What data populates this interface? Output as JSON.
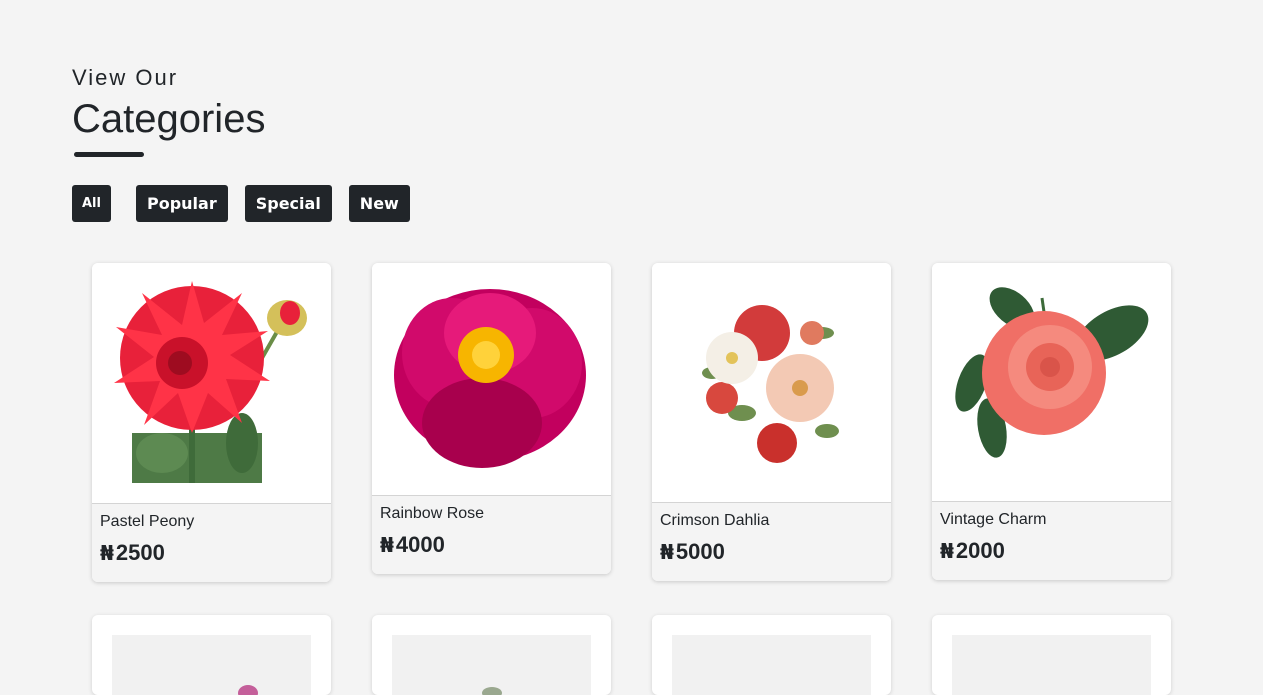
{
  "header": {
    "subtitle": "View Our",
    "title": "Categories"
  },
  "filters": [
    "All",
    "Popular",
    "Special",
    "New"
  ],
  "currency_symbol": "₦",
  "products": [
    {
      "name": "Pastel Peony",
      "price": "2500"
    },
    {
      "name": "Rainbow Rose",
      "price": "4000"
    },
    {
      "name": "Crimson Dahlia",
      "price": "5000"
    },
    {
      "name": "Vintage Charm",
      "price": "2000"
    }
  ],
  "colors": {
    "background": "#f4f4f4",
    "button": "#212529",
    "text": "#212529"
  }
}
